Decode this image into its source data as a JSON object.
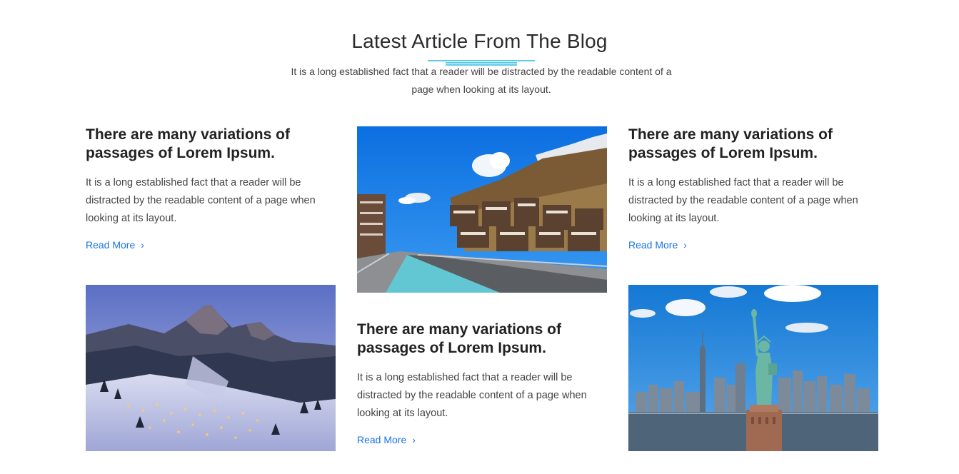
{
  "section": {
    "title": "Latest Article From The Blog",
    "subtitle": "It is a long established fact that a reader will be distracted by the readable content of a page when looking at its layout.",
    "accent_color": "#22b8e0"
  },
  "articles": [
    {
      "title": "There are many variations of passages of Lorem Ipsum.",
      "body": "It is a long established fact that a reader will be distracted by the readable content of a page when looking at its layout.",
      "link": "Read More",
      "chevron": "›"
    },
    {
      "title": "There are many variations of passages of Lorem Ipsum.",
      "body": "It is a long established fact that a reader will be distracted by the readable content of a page when looking at its layout.",
      "link": "Read More",
      "chevron": "›"
    },
    {
      "title": "There are many variations of passages of Lorem Ipsum.",
      "body": "It is a long established fact that a reader will be distracted by the readable content of a page when looking at its layout.",
      "link": "Read More",
      "chevron": "›"
    }
  ],
  "images": {
    "col1": "snowy-mountain-village-night-photo",
    "col2": "alpine-village-river-photo",
    "col3": "statue-of-liberty-skyline-photo"
  },
  "link_color": "#1a73e8"
}
